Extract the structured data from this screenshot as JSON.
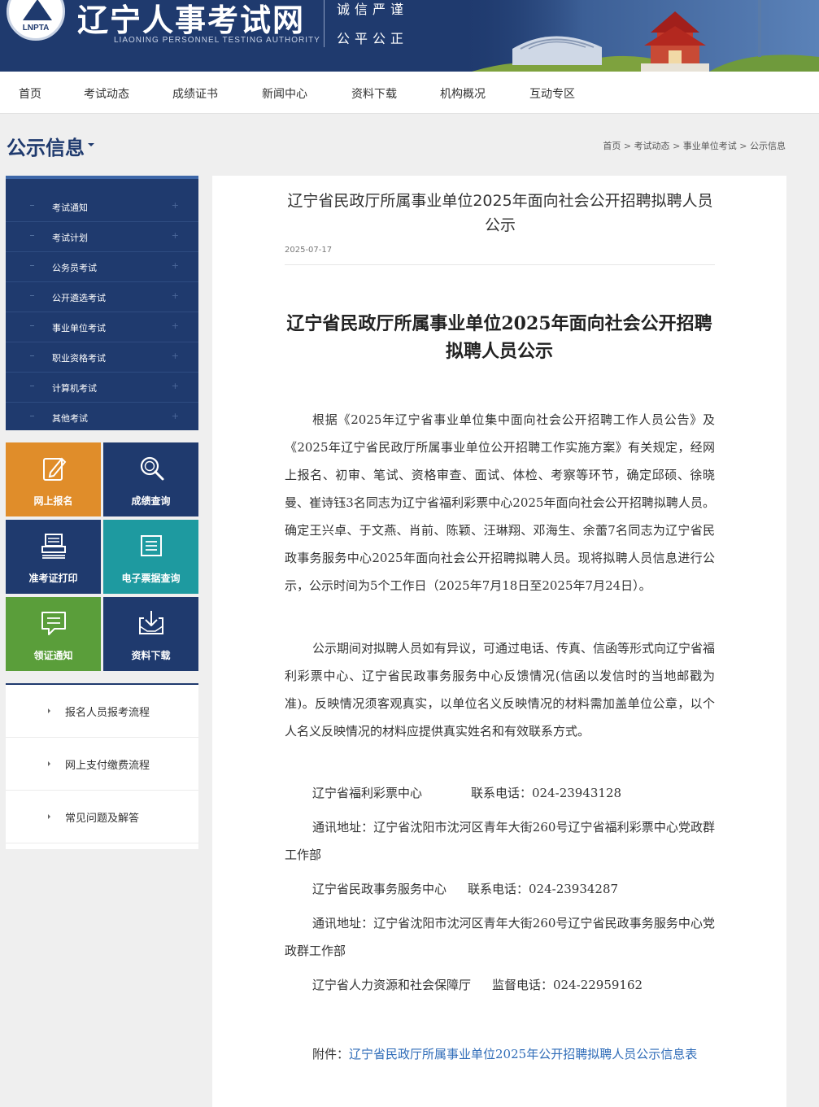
{
  "header": {
    "logo_abbr": "LNPTA",
    "site_title": "辽宁人事考试网",
    "site_subtitle": "LIAONING PERSONNEL TESTING AUTHORITY",
    "motto_line1": "诚信严谨",
    "motto_line2": "公平公正"
  },
  "nav": [
    "首页",
    "考试动态",
    "成绩证书",
    "新闻中心",
    "资料下载",
    "机构概况",
    "互动专区"
  ],
  "section": {
    "title": "公示信息",
    "breadcrumb": [
      "首页",
      "考试动态",
      "事业单位考试",
      "公示信息"
    ],
    "breadcrumb_sep": ">"
  },
  "sidebar": {
    "menu": [
      "考试通知",
      "考试计划",
      "公务员考试",
      "公开遴选考试",
      "事业单位考试",
      "职业资格考试",
      "计算机考试",
      "其他考试"
    ],
    "plus": "+",
    "tiles": [
      {
        "label": "网上报名",
        "icon": "edit-icon",
        "color": "#e08d2a"
      },
      {
        "label": "成绩查询",
        "icon": "search-icon",
        "color": "#1f3a6e"
      },
      {
        "label": "准考证打印",
        "icon": "printer-icon",
        "color": "#1f3a6e"
      },
      {
        "label": "电子票据查询",
        "icon": "receipt-icon",
        "color": "#1e9aa0"
      },
      {
        "label": "领证通知",
        "icon": "message-icon",
        "color": "#5a9e3a"
      },
      {
        "label": "资料下载",
        "icon": "download-icon",
        "color": "#1f3a6e"
      }
    ],
    "links": [
      "报名人员报考流程",
      "网上支付缴费流程",
      "常见问题及解答"
    ]
  },
  "article": {
    "header_title": "辽宁省民政厅所属事业单位2025年面向社会公开招聘拟聘人员公示",
    "date": "2025-07-17",
    "main_title": "辽宁省民政厅所属事业单位2025年面向社会公开招聘拟聘人员公示",
    "para1": "根据《2025年辽宁省事业单位集中面向社会公开招聘工作人员公告》及《2025年辽宁省民政厅所属事业单位公开招聘工作实施方案》有关规定，经网上报名、初审、笔试、资格审查、面试、体检、考察等环节，确定邱硕、徐晓曼、崔诗钰3名同志为辽宁省福利彩票中心2025年面向社会公开招聘拟聘人员。确定王兴卓、于文燕、肖前、陈颖、汪琳翔、邓海生、余蕾7名同志为辽宁省民政事务服务中心2025年面向社会公开招聘拟聘人员。现将拟聘人员信息进行公示，公示时间为5个工作日（2025年7月18日至2025年7月24日）。",
    "para2": "公示期间对拟聘人员如有异议，可通过电话、传真、信函等形式向辽宁省福利彩票中心、辽宁省民政事务服务中心反馈情况(信函以发信时的当地邮戳为准)。反映情况须客观真实，以单位名义反映情况的材料需加盖单位公章，以个人名义反映情况的材料应提供真实姓名和有效联系方式。",
    "contact1_org": "辽宁省福利彩票中心",
    "contact1_phone": "联系电话：024-23943128",
    "contact1_addr": "通讯地址：辽宁省沈阳市沈河区青年大街260号辽宁省福利彩票中心党政群工作部",
    "contact2_org": "辽宁省民政事务服务中心",
    "contact2_phone": "联系电话：024-23934287",
    "contact2_addr": "通讯地址：辽宁省沈阳市沈河区青年大街260号辽宁省民政事务服务中心党政群工作部",
    "contact3_org": "辽宁省人力资源和社会保障厅",
    "contact3_phone": "监督电话：024-22959162",
    "attachment_label": "附件：",
    "attachment_link": "辽宁省民政厅所属事业单位2025年公开招聘拟聘人员公示信息表"
  }
}
